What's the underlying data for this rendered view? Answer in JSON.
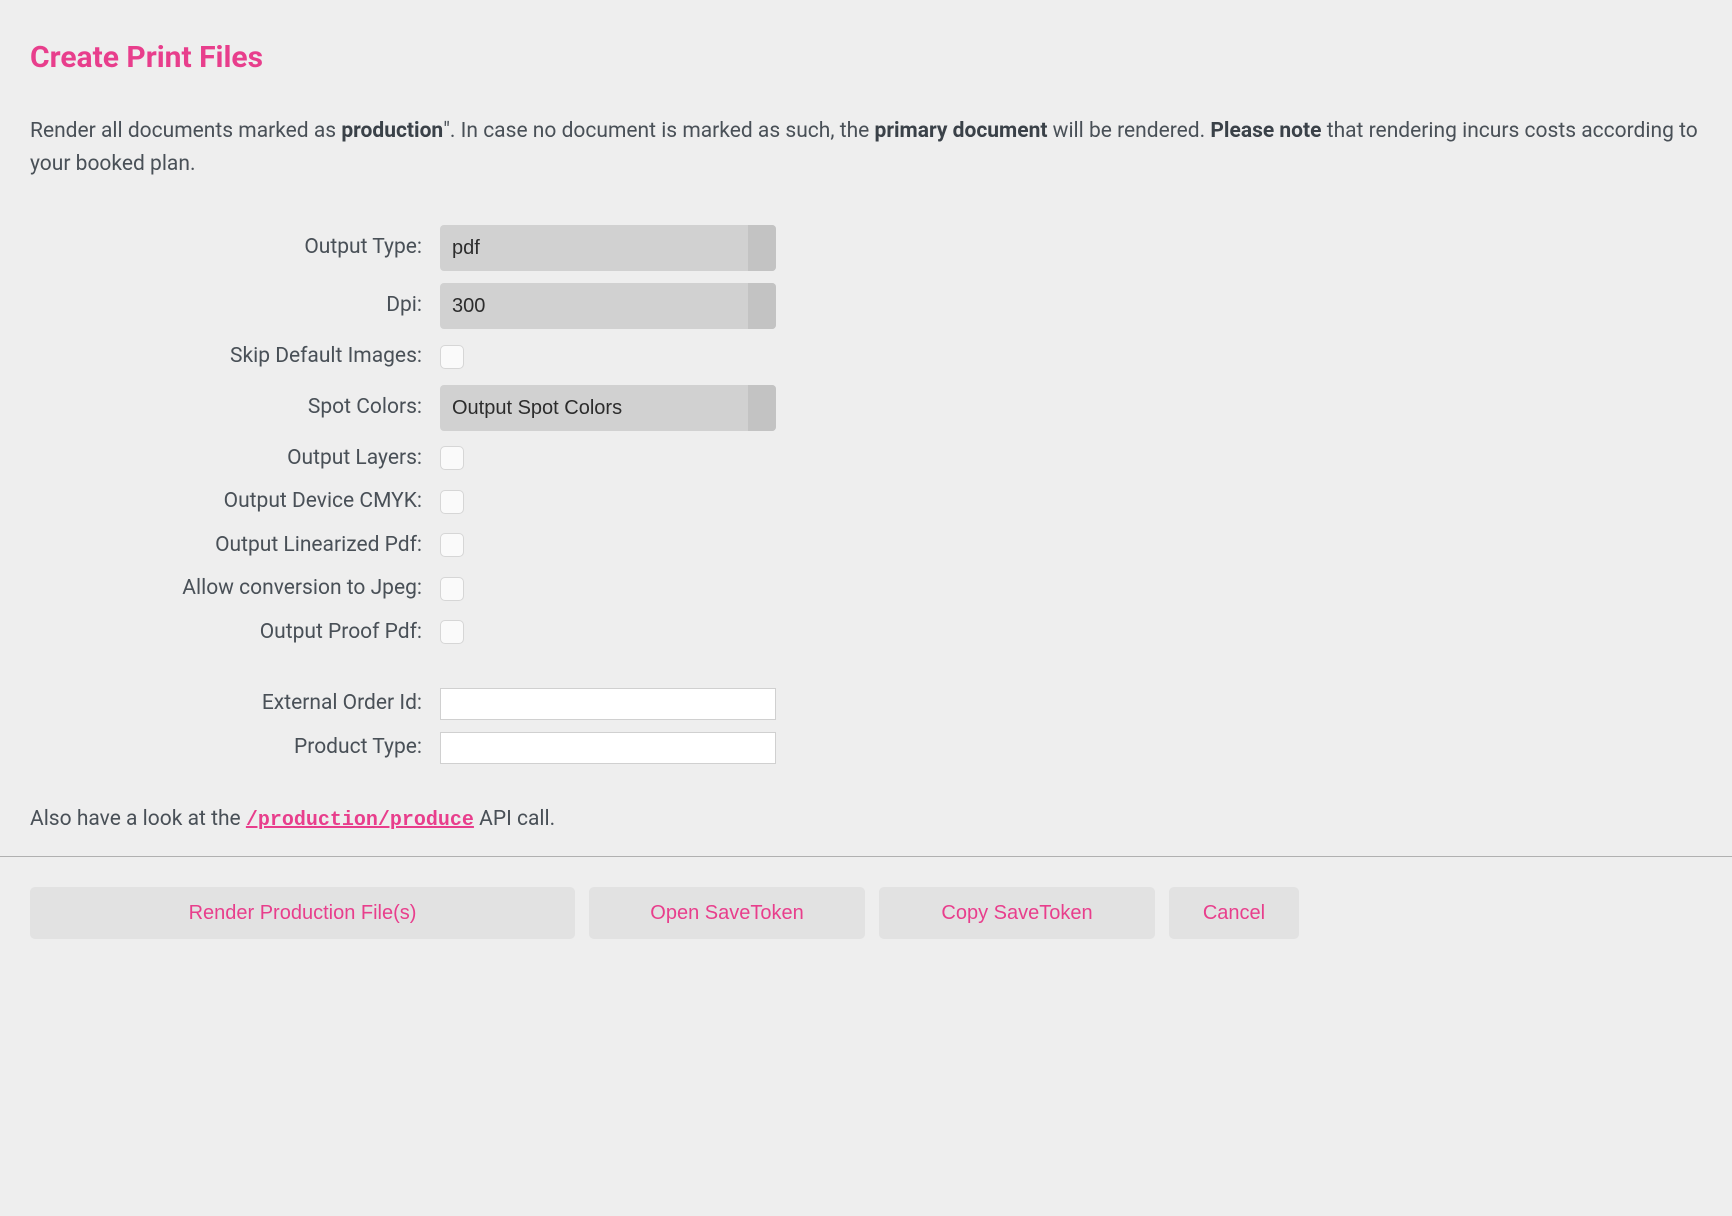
{
  "title": "Create Print Files",
  "description": {
    "part1": "Render all documents marked as ",
    "bold1": "production",
    "part2": "\". In case no document is marked as such, the ",
    "bold2": "primary document",
    "part3": " will be rendered. ",
    "bold3": "Please note",
    "part4": " that rendering incurs costs according to your booked plan."
  },
  "fields": {
    "output_type": {
      "label": "Output Type:",
      "value": "pdf"
    },
    "dpi": {
      "label": "Dpi:",
      "value": "300"
    },
    "skip_default_images": {
      "label": "Skip Default Images:"
    },
    "spot_colors": {
      "label": "Spot Colors:",
      "value": "Output Spot Colors"
    },
    "output_layers": {
      "label": "Output Layers:"
    },
    "output_device_cmyk": {
      "label": "Output Device CMYK:"
    },
    "output_linearized_pdf": {
      "label": "Output Linearized Pdf:"
    },
    "allow_jpeg": {
      "label": "Allow conversion to Jpeg:"
    },
    "output_proof_pdf": {
      "label": "Output Proof Pdf:"
    },
    "external_order_id": {
      "label": "External Order Id:",
      "value": ""
    },
    "product_type": {
      "label": "Product Type:",
      "value": ""
    }
  },
  "footer": {
    "part1": "Also have a look at the ",
    "link": "/production/produce",
    "part2": " API call."
  },
  "buttons": {
    "render": "Render Production File(s)",
    "open_token": "Open SaveToken",
    "copy_token": "Copy SaveToken",
    "cancel": "Cancel"
  }
}
